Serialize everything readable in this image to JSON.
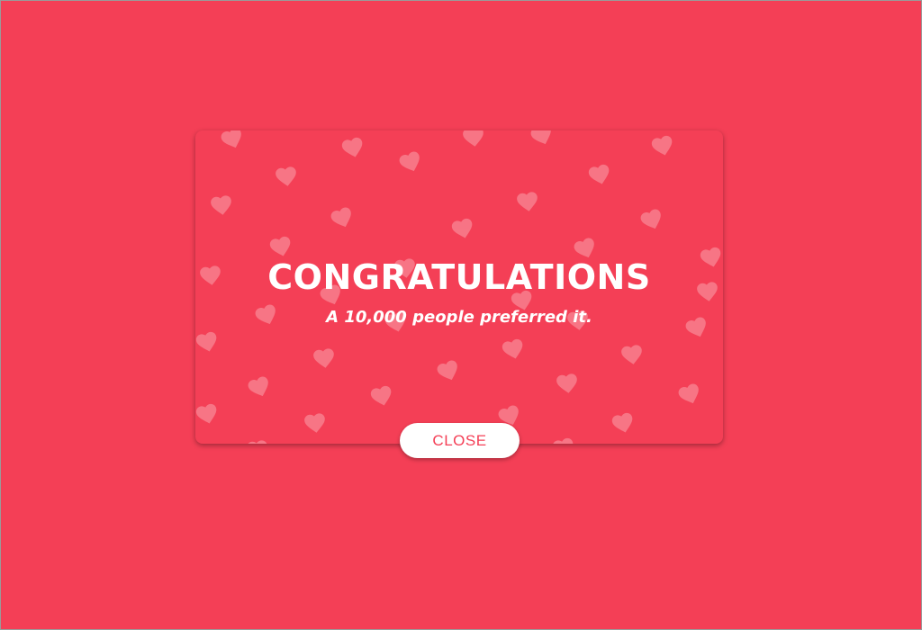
{
  "modal": {
    "title": "CONGRATULATIONS",
    "subtitle": "A 10,000 people preferred it.",
    "close_label": "CLOSE",
    "pattern_icon": "heart-icon"
  },
  "colors": {
    "background": "#f43f56",
    "accent": "#f43f56",
    "text": "#ffffff",
    "button_bg": "#ffffff"
  }
}
